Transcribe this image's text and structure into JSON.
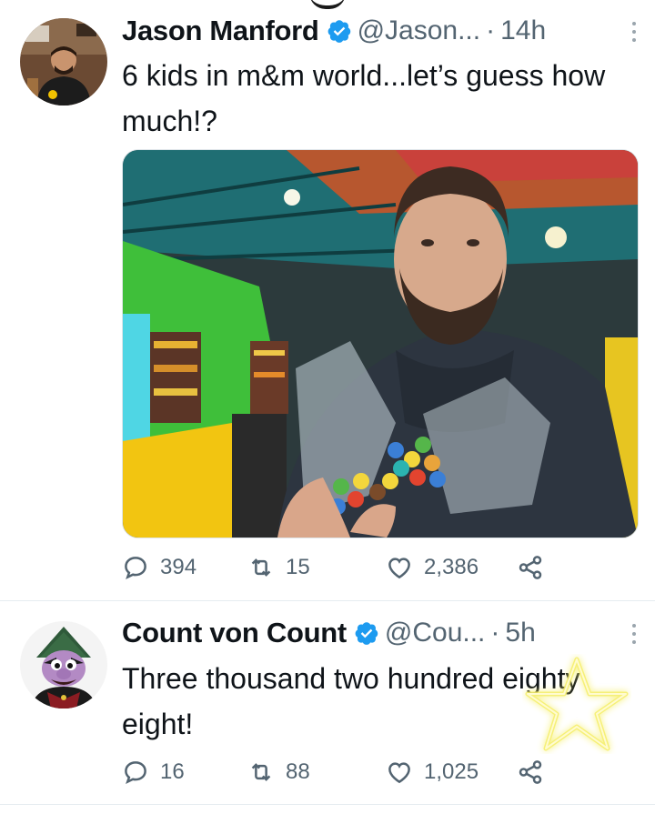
{
  "tweets": [
    {
      "author": {
        "display_name": "Jason Manford",
        "handle": "@Jason...",
        "verified": true,
        "avatar": "jason-manford-avatar"
      },
      "time": "14h",
      "separator": "·",
      "text": "6 kids in m&m world...let’s guess how much!?",
      "media": "selfie-holding-bags-of-mms-photo",
      "stats": {
        "replies": "394",
        "retweets": "15",
        "likes": "2,386"
      }
    },
    {
      "author": {
        "display_name": "Count von Count",
        "handle": "@Cou...",
        "verified": true,
        "avatar": "count-von-count-avatar"
      },
      "time": "5h",
      "separator": "·",
      "text": "Three thousand two hundred eighty eight!",
      "overlay": "glowing-star-sticker",
      "stats": {
        "replies": "16",
        "retweets": "88",
        "likes": "1,025"
      }
    }
  ],
  "icons": {
    "reply": "reply-icon",
    "retweet": "retweet-icon",
    "like": "heart-icon",
    "share": "share-icon",
    "verified": "verified-badge-icon",
    "more": "more-options-icon"
  },
  "colors": {
    "text": "#0f1419",
    "secondary": "#536471",
    "verified": "#1d9bf0",
    "divider": "#e6ecf0"
  }
}
